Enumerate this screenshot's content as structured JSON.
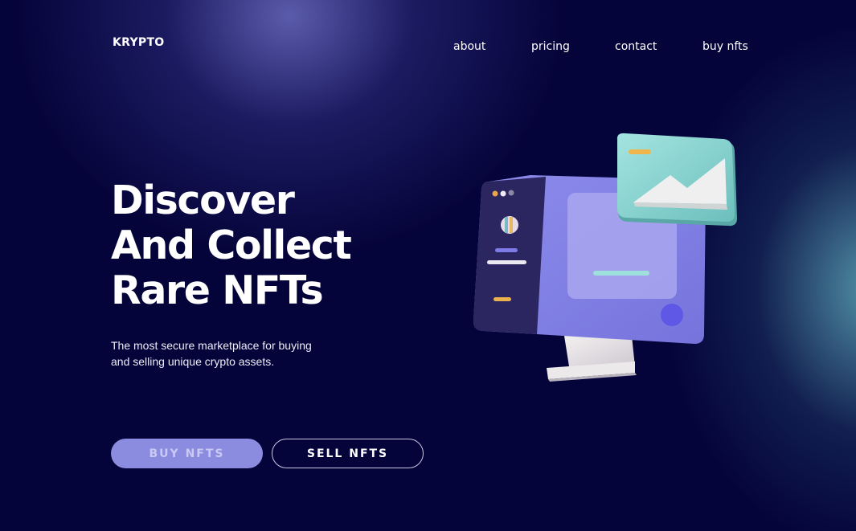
{
  "brand": {
    "logo": "KRYPTO"
  },
  "nav": {
    "items": [
      {
        "label": "about"
      },
      {
        "label": "pricing"
      },
      {
        "label": "contact"
      },
      {
        "label": "buy nfts"
      }
    ]
  },
  "hero": {
    "title_lines": [
      "Discover",
      "And Collect",
      "Rare NFTs"
    ],
    "subtitle": "The most secure marketplace for buying and selling unique crypto assets.",
    "buy_button": "BUY NFTS",
    "sell_button": "SELL NFTS"
  },
  "illustration": {
    "icon": "monitor-nft-illustration",
    "colors": {
      "screen": "#8584e6",
      "sidebar": "#2b2660",
      "card": "#8ed3cf",
      "accent": "#5f57e6",
      "stand": "#e6e2e4"
    }
  }
}
